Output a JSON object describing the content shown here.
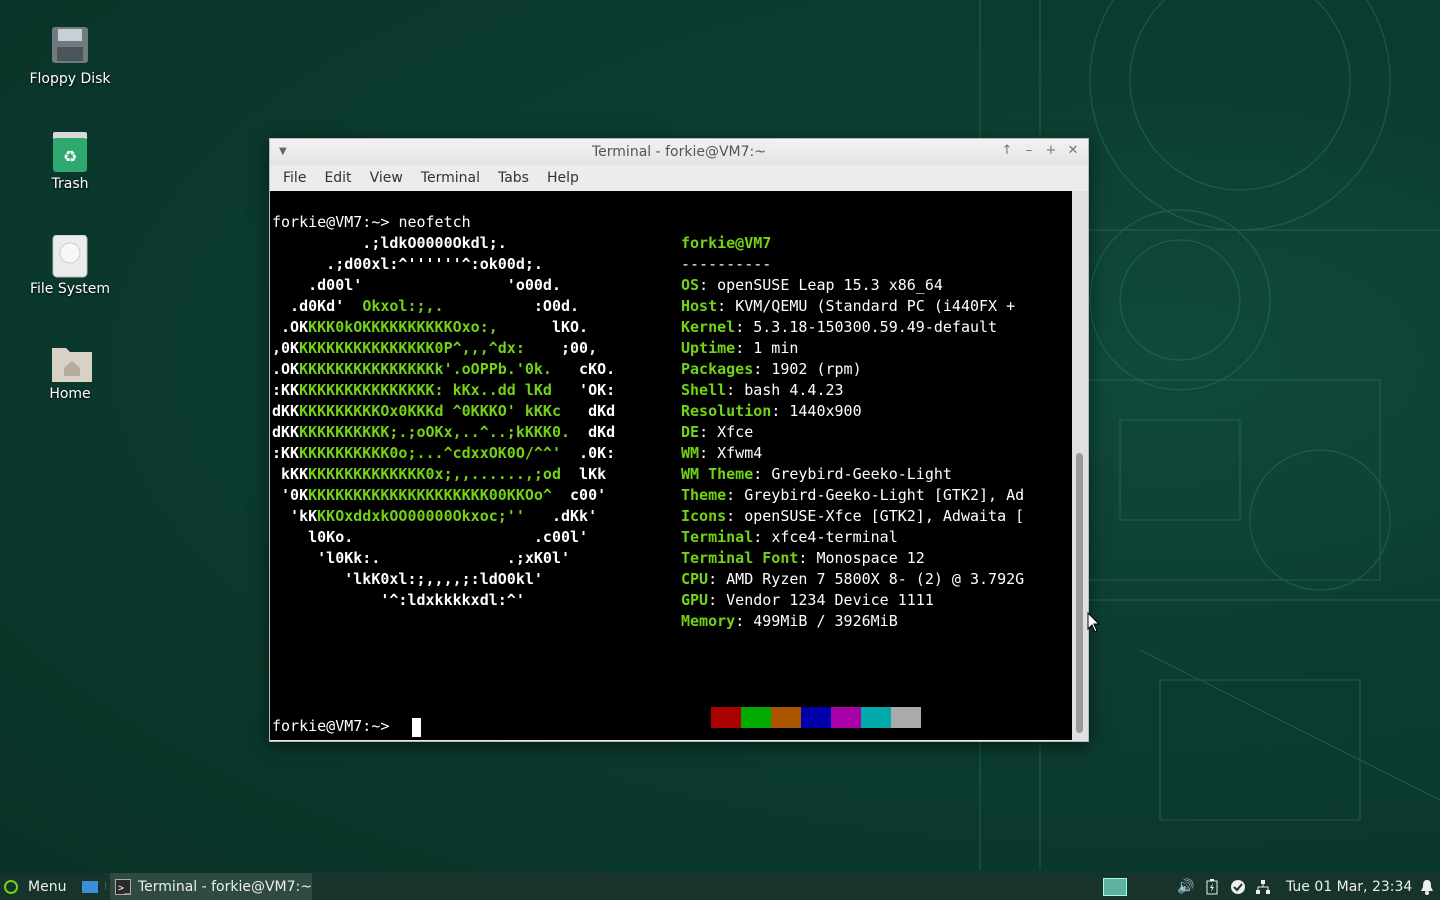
{
  "desktop": {
    "icons": [
      {
        "label": "Floppy Disk",
        "icon": "floppy-disk-icon"
      },
      {
        "label": "Trash",
        "icon": "trash-icon"
      },
      {
        "label": "File System",
        "icon": "hard-drive-icon"
      },
      {
        "label": "Home",
        "icon": "home-folder-icon"
      }
    ]
  },
  "window": {
    "title": "Terminal - forkie@VM7:~",
    "menu": [
      "File",
      "Edit",
      "View",
      "Terminal",
      "Tabs",
      "Help"
    ]
  },
  "terminal": {
    "prompt": "forkie@VM7:~> ",
    "command": "neofetch",
    "logo": [
      [
        [
          "w",
          "          .;ldkO0000Okdl;."
        ]
      ],
      [
        [
          "w",
          "      .;d00xl:^''''''^:ok00d;."
        ]
      ],
      [
        [
          "w",
          "    .d00l'                'o00d."
        ]
      ],
      [
        [
          "w",
          "  .d0Kd'  "
        ],
        [
          "g",
          "Okxol:;,."
        ],
        [
          "w",
          "          :O0d."
        ]
      ],
      [
        [
          "w",
          " .OK"
        ],
        [
          "g",
          "KKK0kOKKKKKKKKKKOxo:,"
        ],
        [
          "w",
          "      lKO."
        ]
      ],
      [
        [
          "w",
          ",0K"
        ],
        [
          "g",
          "KKKKKKKKKKKKKKK0P^,,,^dx:"
        ],
        [
          "w",
          "    ;00,"
        ]
      ],
      [
        [
          "w",
          ".OK"
        ],
        [
          "g",
          "KKKKKKKKKKKKKKKk'.oOPPb.'0k."
        ],
        [
          "w",
          "   cKO."
        ]
      ],
      [
        [
          "w",
          ":KK"
        ],
        [
          "g",
          "KKKKKKKKKKKKKKK: kKx..dd lKd"
        ],
        [
          "w",
          "   'OK:"
        ]
      ],
      [
        [
          "w",
          "dKK"
        ],
        [
          "g",
          "KKKKKKKKKOx0KKKd ^0KKKO' kKKc"
        ],
        [
          "w",
          "   dKd"
        ]
      ],
      [
        [
          "w",
          "dKK"
        ],
        [
          "g",
          "KKKKKKKKKK;.;oOKx,..^..;kKKK0."
        ],
        [
          "w",
          "  dKd"
        ]
      ],
      [
        [
          "w",
          ":KK"
        ],
        [
          "g",
          "KKKKKKKKKK0o;...^cdxxOK0O/^^'"
        ],
        [
          "w",
          "  .0K:"
        ]
      ],
      [
        [
          "w",
          " kKK"
        ],
        [
          "g",
          "KKKKKKKKKKKKK0x;,,......,;od"
        ],
        [
          "w",
          "  lKk"
        ]
      ],
      [
        [
          "w",
          " '0K"
        ],
        [
          "g",
          "KKKKKKKKKKKKKKKKKKKK00KKOo^"
        ],
        [
          "w",
          "  c00'"
        ]
      ],
      [
        [
          "w",
          "  'kK"
        ],
        [
          "g",
          "KKOxddxkOO00000Okxoc;''"
        ],
        [
          "w",
          "   .dKk'"
        ]
      ],
      [
        [
          "w",
          "    l0Ko.                    .c00l'"
        ]
      ],
      [
        [
          "w",
          "     'l0Kk:.              .;xK0l'"
        ]
      ],
      [
        [
          "w",
          "        'lkK0xl:;,,,,;:ldO0kl'"
        ]
      ],
      [
        [
          "w",
          "            '^:ldxkkkkxdl:^'"
        ]
      ]
    ],
    "user_host": "forkie@VM7",
    "separator": "----------",
    "info": [
      {
        "key": "OS",
        "value": "openSUSE Leap 15.3 x86_64"
      },
      {
        "key": "Host",
        "value": "KVM/QEMU (Standard PC (i440FX +"
      },
      {
        "key": "Kernel",
        "value": "5.3.18-150300.59.49-default"
      },
      {
        "key": "Uptime",
        "value": "1 min"
      },
      {
        "key": "Packages",
        "value": "1902 (rpm)"
      },
      {
        "key": "Shell",
        "value": "bash 4.4.23"
      },
      {
        "key": "Resolution",
        "value": "1440x900"
      },
      {
        "key": "DE",
        "value": "Xfce"
      },
      {
        "key": "WM",
        "value": "Xfwm4"
      },
      {
        "key": "WM Theme",
        "value": "Greybird-Geeko-Light"
      },
      {
        "key": "Theme",
        "value": "Greybird-Geeko-Light [GTK2], Ad"
      },
      {
        "key": "Icons",
        "value": "openSUSE-Xfce [GTK2], Adwaita ["
      },
      {
        "key": "Terminal",
        "value": "xfce4-terminal"
      },
      {
        "key": "Terminal Font",
        "value": "Monospace 12"
      },
      {
        "key": "CPU",
        "value": "AMD Ryzen 7 5800X 8- (2) @ 3.792G"
      },
      {
        "key": "GPU",
        "value": "Vendor 1234 Device 1111"
      },
      {
        "key": "Memory",
        "value": "499MiB / 3926MiB"
      }
    ],
    "palette": [
      "#000000",
      "#aa0000",
      "#00aa00",
      "#aa5500",
      "#0000aa",
      "#aa00aa",
      "#00aaaa",
      "#aaaaaa"
    ]
  },
  "taskbar": {
    "menu_label": "Menu",
    "task_label": "Terminal - forkie@VM7:~",
    "clock": "Tue 01 Mar, 23:34"
  }
}
